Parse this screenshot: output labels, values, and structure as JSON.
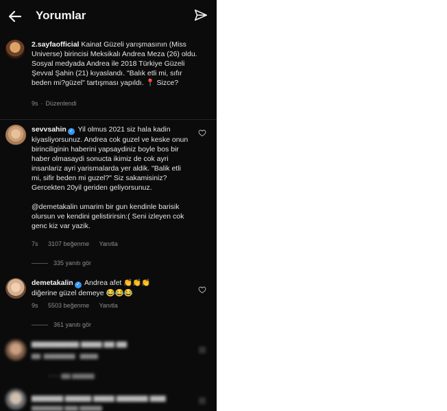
{
  "header": {
    "title": "Yorumlar"
  },
  "caption": {
    "username": "2.sayfaofficial",
    "text": "Kainat Güzeli yarışmasının (Miss Universe) birincisi Meksikalı Andrea Meza (26) oldu. Sosyal medyada Andrea ile 2018 Türkiye Güzeli Şevval Şahin (21) kıyaslandı. \"Balık etli mi, sıfır beden mi?güzel\" tartışması yapıldı. 📍 Sizce?",
    "time": "9s",
    "edited": "Düzenlendi"
  },
  "comments": [
    {
      "username": "sevvsahin",
      "text_p1": "Yil olmus 2021 siz hala kadin kiyasliyorsunuz. Andrea cok guzel ve keske onun birinciliginin haberini yapsaydiniz boyle bos bir haber olmasaydi sonucta ikimiz de cok ayri insanlariz ayri yarismalarda yer aldik. \"Balik etli mi, sifir beden mi guzel?\" Siz sakamisiniz? Gercekten 20yil geriden geliyorsunuz.",
      "text_p2": "@demetakalin umarim bir gun kendinle barisik olursun ve kendini gelistirirsin:( Seni izleyen cok genc kiz var yazik.",
      "time": "7s",
      "likes": "3107 beğenme",
      "reply": "Yanıtla",
      "view_replies": "335 yanıtı gör"
    },
    {
      "username": "demetakalin",
      "text": "Andrea afet 👏👏👏 diğerine güzel demeye 😂😂😂",
      "time": "9s",
      "likes": "5503 beğenme",
      "reply": "Yanıtla",
      "view_replies": "361 yanıtı gör"
    }
  ],
  "icons": {
    "back": "arrow-left-icon",
    "send": "paper-plane-icon",
    "like": "heart-outline-icon",
    "verified": "verified-badge-icon"
  },
  "colors": {
    "background": "#0b0b0b",
    "verified": "#3897f0",
    "muted": "#8e8e8e"
  }
}
